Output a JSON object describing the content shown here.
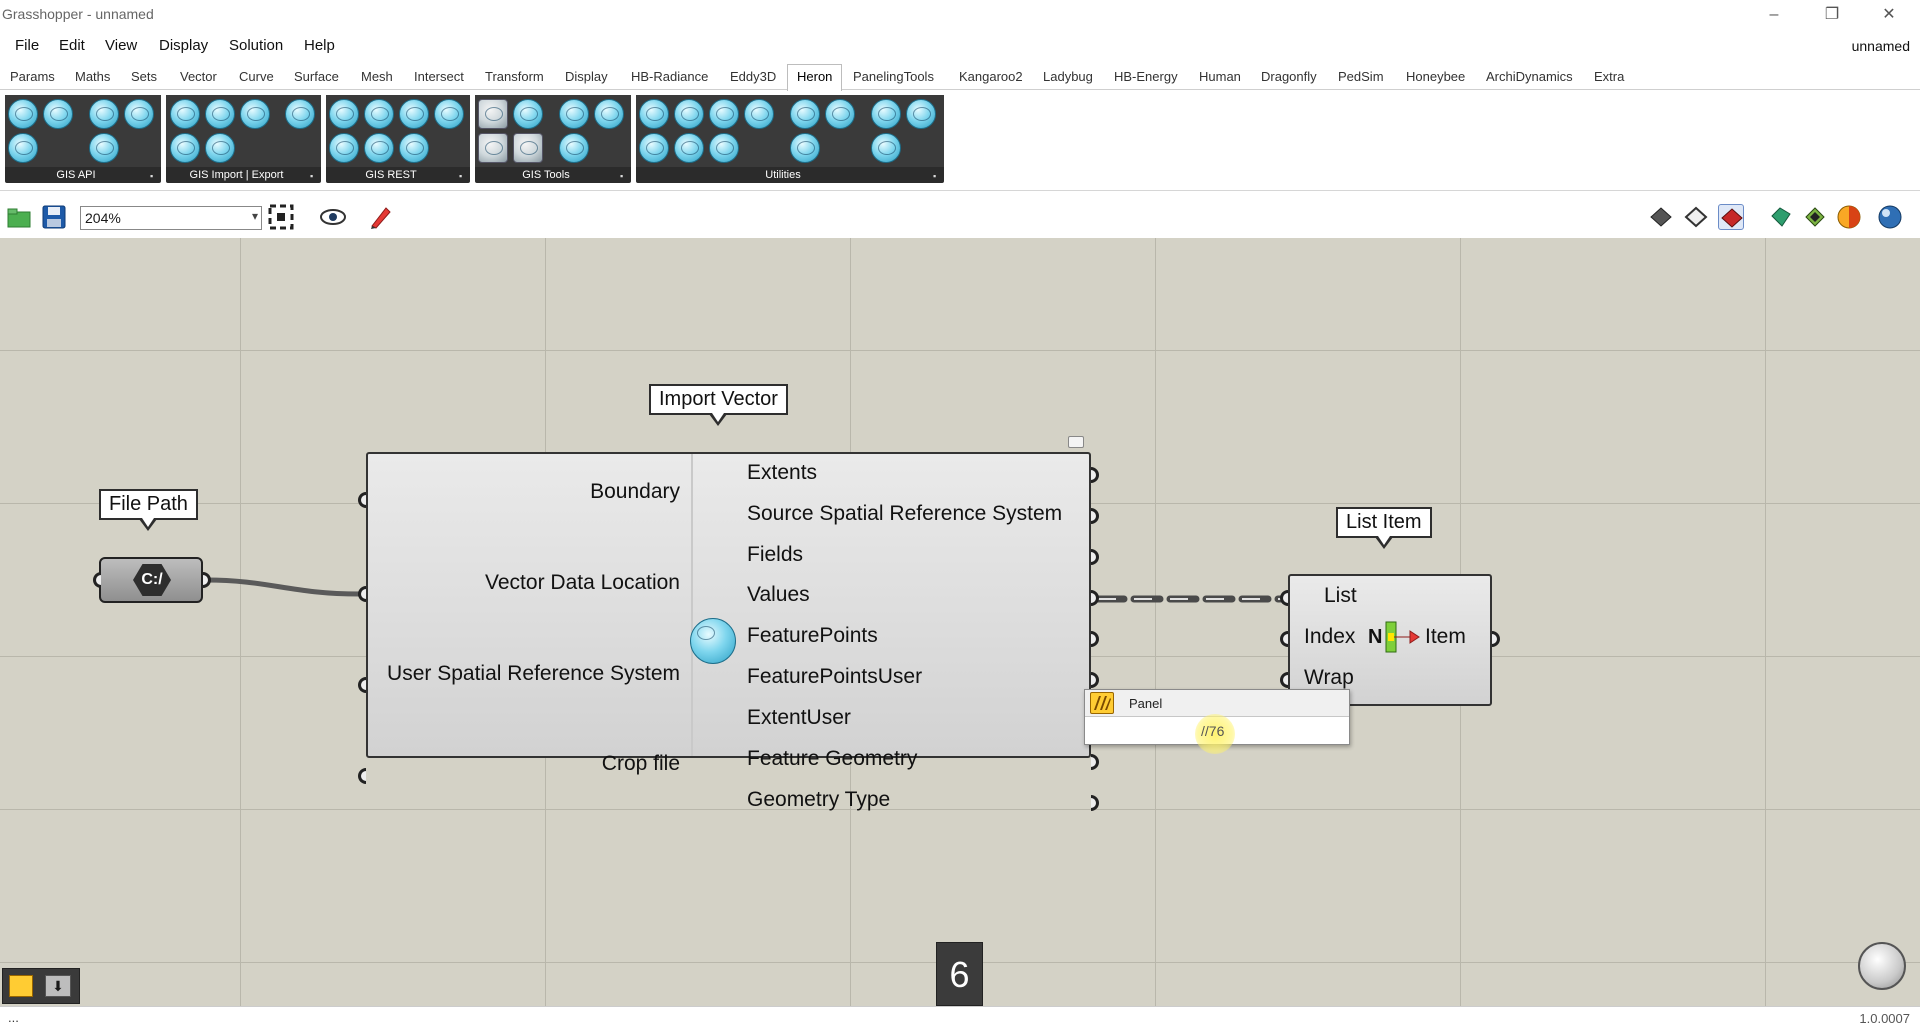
{
  "window": {
    "title": "Grasshopper - unnamed",
    "minimize": "–",
    "restore": "❐",
    "close": "✕"
  },
  "menu": {
    "items": [
      "File",
      "Edit",
      "View",
      "Display",
      "Solution",
      "Help"
    ],
    "document_name": "unnamed"
  },
  "tabs": [
    "Params",
    "Maths",
    "Sets",
    "Vector",
    "Curve",
    "Surface",
    "Mesh",
    "Intersect",
    "Transform",
    "Display",
    "HB-Radiance",
    "Eddy3D",
    "Heron",
    "PanelingTools",
    "Kangaroo2",
    "Ladybug",
    "HB-Energy",
    "Human",
    "Dragonfly",
    "PedSim",
    "Honeybee",
    "ArchiDynamics",
    "Extra"
  ],
  "active_tab": "Heron",
  "ribbon_groups": [
    {
      "label": "GIS API",
      "more": "▪"
    },
    {
      "label": "GIS Import | Export",
      "more": "▪"
    },
    {
      "label": "GIS REST",
      "more": "▪"
    },
    {
      "label": "GIS Tools",
      "more": "▪"
    },
    {
      "label": "Utilities",
      "more": "▪"
    }
  ],
  "toolbar": {
    "zoom": "204%"
  },
  "canvas": {
    "file_path_bubble": "File Path",
    "file_path_param": "C:/",
    "import_vector_bubble": "Import Vector",
    "import_vector_inputs": [
      "Boundary",
      "Vector Data Location",
      "User Spatial Reference System",
      "Crop file"
    ],
    "import_vector_outputs": [
      "Extents",
      "Source Spatial Reference System",
      "Fields",
      "Values",
      "FeaturePoints",
      "FeaturePointsUser",
      "ExtentUser",
      "Feature Geometry",
      "Geometry Type"
    ],
    "list_item_bubble": "List Item",
    "list_item_inputs": [
      "List",
      "Index",
      "Wrap"
    ],
    "list_item_output": "Item",
    "list_item_index_glyph": "N",
    "tooltip_title": "Panel",
    "tooltip_value": "//76",
    "counter": "6"
  },
  "status": {
    "left": "...",
    "version": "1.0.0007"
  },
  "colors": {
    "canvas_bg": "#d4d2c6",
    "grid_line": "#b9b7ab",
    "ribbon_group_bg": "#3a3a3a",
    "wire": "#5a5a5a",
    "highlight": "#fff36a"
  }
}
